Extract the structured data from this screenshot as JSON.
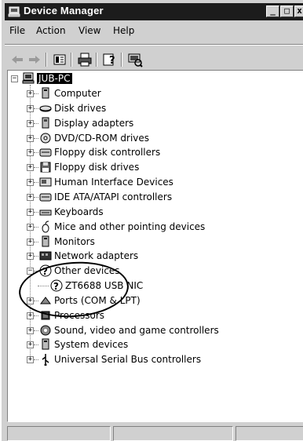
{
  "window": {
    "title": "Device Manager",
    "title_icon": "device-manager-icon",
    "controls": [
      "minimize",
      "maximize",
      "close"
    ]
  },
  "menu": [
    {
      "label": "File"
    },
    {
      "label": "Action"
    },
    {
      "label": "View"
    },
    {
      "label": "Help"
    }
  ],
  "toolbar": {
    "buttons": [
      "back-arrow-icon",
      "forward-arrow-icon",
      "properties-icon",
      "print-icon",
      "help-icon",
      "scan-hardware-icon"
    ]
  },
  "tree": {
    "root": {
      "label": "JUB-PC",
      "icon": "computer-icon",
      "expanded": true,
      "selected": true
    },
    "children": [
      {
        "label": "Computer",
        "icon": "computer-icon",
        "expanded": false
      },
      {
        "label": "Disk drives",
        "icon": "disk-drive-icon",
        "expanded": false
      },
      {
        "label": "Display adapters",
        "icon": "display-adapter-icon",
        "expanded": false
      },
      {
        "label": "DVD/CD-ROM drives",
        "icon": "dvd-drive-icon",
        "expanded": false
      },
      {
        "label": "Floppy disk controllers",
        "icon": "controller-icon",
        "expanded": false
      },
      {
        "label": "Floppy disk drives",
        "icon": "floppy-drive-icon",
        "expanded": false
      },
      {
        "label": "Human Interface Devices",
        "icon": "hid-icon",
        "expanded": false
      },
      {
        "label": "IDE ATA/ATAPI controllers",
        "icon": "controller-icon",
        "expanded": false
      },
      {
        "label": "Keyboards",
        "icon": "keyboard-icon",
        "expanded": false
      },
      {
        "label": "Mice and other pointing devices",
        "icon": "mouse-icon",
        "expanded": false
      },
      {
        "label": "Monitors",
        "icon": "monitor-icon",
        "expanded": false
      },
      {
        "label": "Network adapters",
        "icon": "network-adapter-icon",
        "expanded": false
      },
      {
        "label": "Other devices",
        "icon": "unknown-device-icon",
        "expanded": true,
        "children": [
          {
            "label": "ZT6688 USB NIC",
            "icon": "unknown-device-icon"
          }
        ]
      },
      {
        "label": "Ports (COM & LPT)",
        "icon": "port-icon",
        "expanded": false
      },
      {
        "label": "Processors",
        "icon": "processor-icon",
        "expanded": false
      },
      {
        "label": "Sound, video and game controllers",
        "icon": "sound-icon",
        "expanded": false
      },
      {
        "label": "System devices",
        "icon": "system-device-icon",
        "expanded": false
      },
      {
        "label": "Universal Serial Bus controllers",
        "icon": "usb-icon",
        "expanded": false
      }
    ]
  },
  "statusbar": {
    "panes": [
      "",
      "",
      ""
    ]
  }
}
